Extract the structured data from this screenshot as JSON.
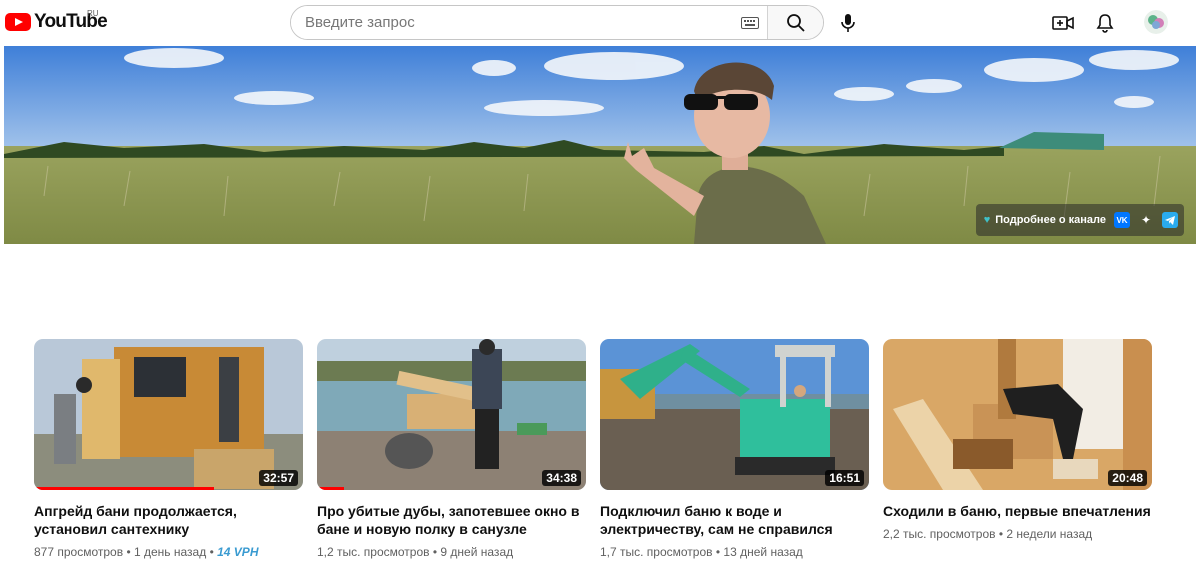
{
  "header": {
    "logo_text": "YouTube",
    "region": "RU",
    "search_placeholder": "Введите запрос",
    "icons": [
      "keyboard-icon",
      "search-icon",
      "microphone-icon",
      "create-video-icon",
      "notifications-bell-icon"
    ]
  },
  "banner": {
    "more_label": "Подробнее о канале",
    "links": [
      "VK",
      "✦",
      "telegram"
    ]
  },
  "videos": [
    {
      "title": "Апгрейд бани продолжается, установил сантехнику",
      "views": "877 просмотров",
      "age": "1 день назад",
      "extra": "14 VPH",
      "duration": "32:57",
      "watched_fraction": 0.67
    },
    {
      "title": "Про убитые дубы, запотевшее окно в бане и новую полку в санузле",
      "views": "1,2 тыс. просмотров",
      "age": "9 дней назад",
      "duration": "34:38",
      "watched_fraction": 0.1
    },
    {
      "title": "Подключил баню к воде и электричеству, сам не справился",
      "views": "1,7 тыс. просмотров",
      "age": "13 дней назад",
      "duration": "16:51"
    },
    {
      "title": "Сходили в баню, первые впечатления",
      "views": "2,2 тыс. просмотров",
      "age": "2 недели назад",
      "duration": "20:48"
    }
  ],
  "colors": {
    "brand_red": "#ff0000",
    "vph_blue": "#3a9bd1",
    "meta_gray": "#606060"
  }
}
